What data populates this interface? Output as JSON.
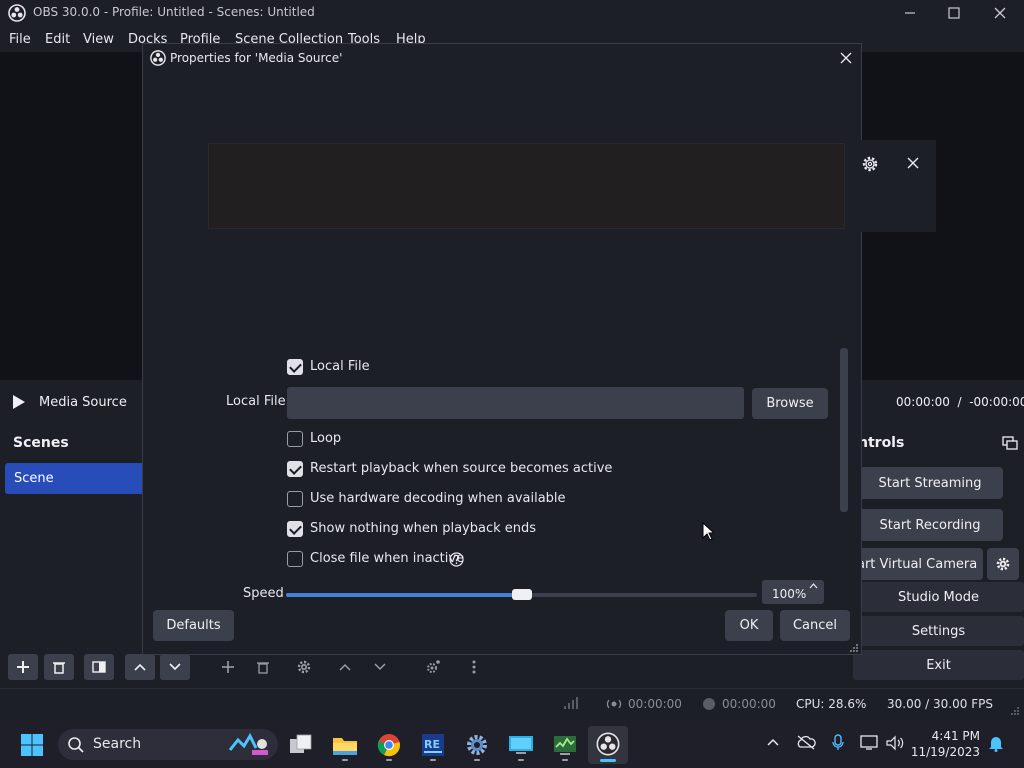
{
  "window": {
    "title": "OBS 30.0.0 - Profile: Untitled - Scenes: Untitled"
  },
  "menu": [
    "File",
    "Edit",
    "View",
    "Docks",
    "Profile",
    "Scene Collection",
    "Tools",
    "Help"
  ],
  "media": {
    "source_name": "Media Source",
    "time": "00:00:00  /  -00:00:00"
  },
  "scenes": {
    "title": "Scenes",
    "items": [
      "Scene"
    ]
  },
  "controls": {
    "title": "ntrols",
    "start_streaming": "Start Streaming",
    "start_recording": "Start Recording",
    "start_virtual_camera": "art Virtual Camera",
    "studio_mode": "Studio Mode",
    "settings": "Settings",
    "exit": "Exit"
  },
  "statusbar": {
    "stream_time": "00:00:00",
    "record_time": "00:00:00",
    "cpu": "CPU: 28.6%",
    "fps": "30.00 / 30.00 FPS"
  },
  "dialog": {
    "title": "Properties for 'Media Source'",
    "local_file_checkbox": {
      "label": "Local File",
      "checked": true
    },
    "local_file_label": "Local File",
    "local_file_value": "",
    "browse": "Browse",
    "loop": {
      "label": "Loop",
      "checked": false
    },
    "restart": {
      "label": "Restart playback when source becomes active",
      "checked": true
    },
    "hw_decoding": {
      "label": "Use hardware decoding when available",
      "checked": false
    },
    "show_nothing": {
      "label": "Show nothing when playback ends",
      "checked": true
    },
    "close_inactive": {
      "label": "Close file when inactive",
      "checked": false
    },
    "speed_label": "Speed",
    "speed_value": "100%",
    "speed_fraction": 0.5,
    "defaults": "Defaults",
    "ok": "OK",
    "cancel": "Cancel"
  },
  "taskbar": {
    "search_placeholder": "Search",
    "time": "4:41 PM",
    "date": "11/19/2023"
  },
  "colors": {
    "accent": "#3f82d6",
    "scene_selected": "#284cb8",
    "background": "#1d1f26"
  }
}
